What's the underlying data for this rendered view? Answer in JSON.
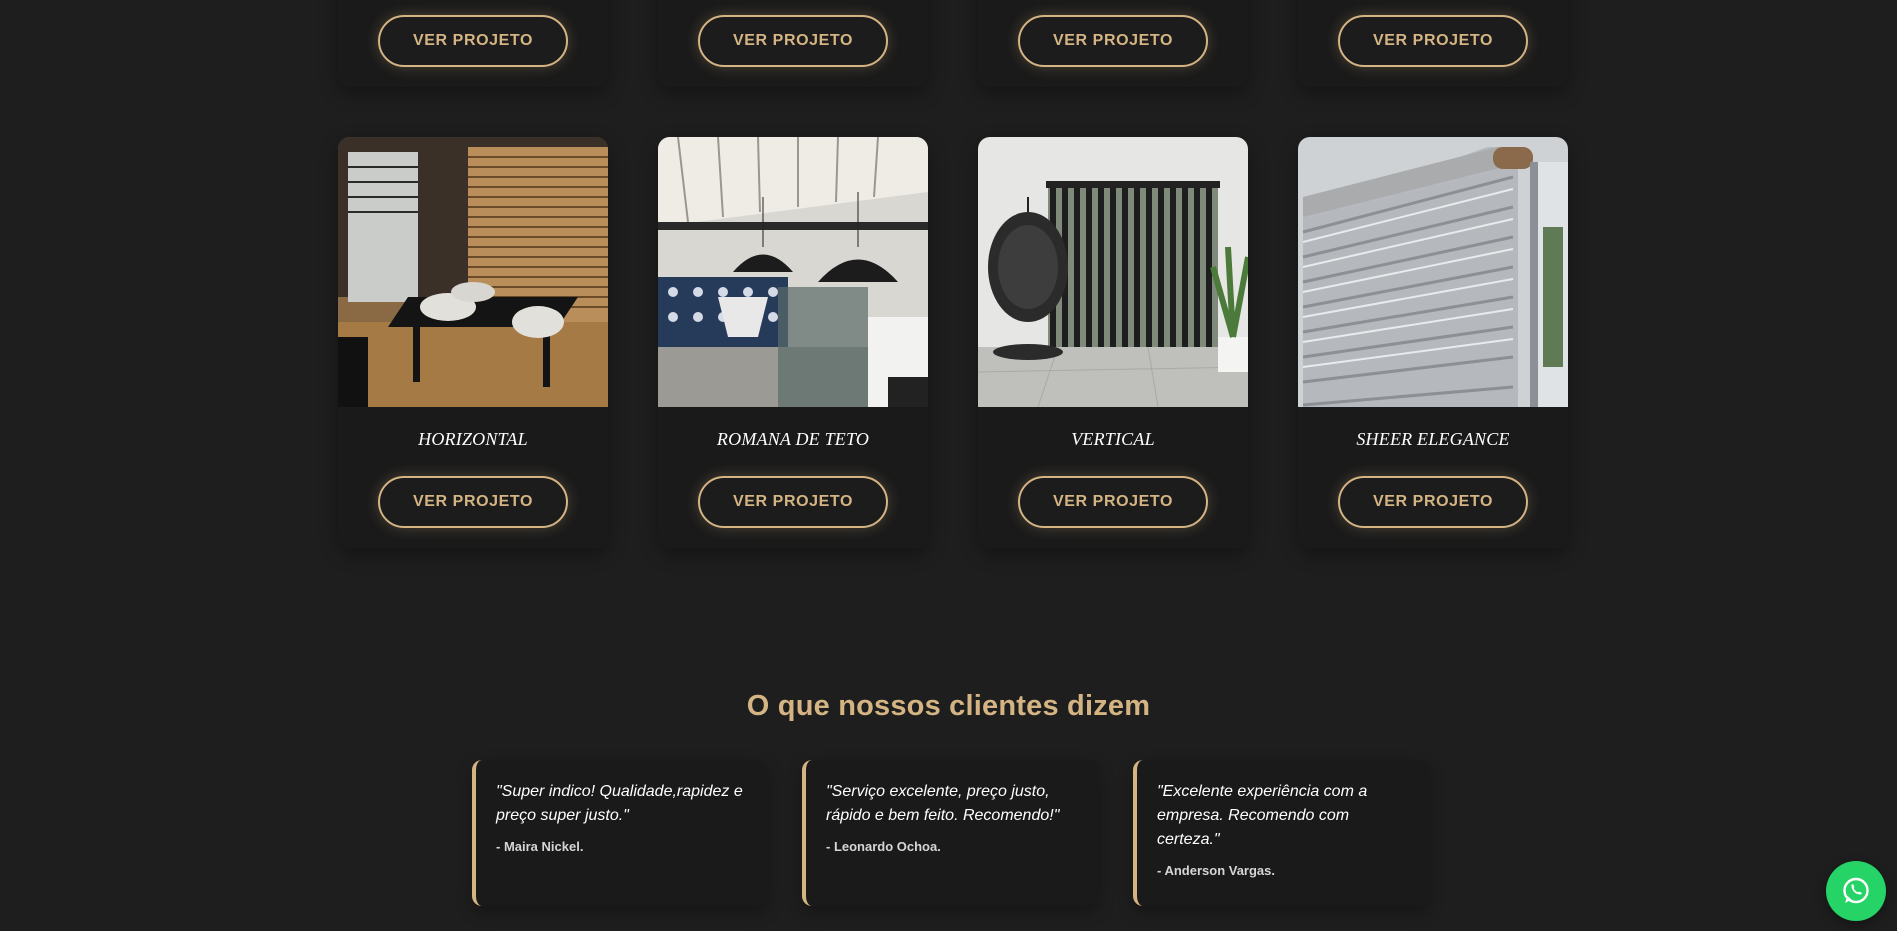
{
  "projects_top_row": [
    {
      "button_label": "VER PROJETO"
    },
    {
      "button_label": "VER PROJETO"
    },
    {
      "button_label": "VER PROJETO"
    },
    {
      "button_label": "VER PROJETO"
    }
  ],
  "projects": [
    {
      "title": "HORIZONTAL",
      "button_label": "VER PROJETO",
      "image": "horizontal-blinds-dining-room-photo"
    },
    {
      "title": "ROMANA DE TETO",
      "button_label": "VER PROJETO",
      "image": "roman-ceiling-shade-patio-photo"
    },
    {
      "title": "VERTICAL",
      "button_label": "VER PROJETO",
      "image": "vertical-blinds-living-room-photo"
    },
    {
      "title": "SHEER ELEGANCE",
      "button_label": "VER PROJETO",
      "image": "sheer-elegance-blind-closeup-photo"
    }
  ],
  "testimonials": {
    "heading": "O que nossos clientes dizem",
    "items": [
      {
        "quote": "\"Super indico! Qualidade,rapidez e preço super justo.\"",
        "author": "- Maira Nickel."
      },
      {
        "quote": "\"Serviço excelente, preço justo, rápido e bem feito. Recomendo!\"",
        "author": "- Leonardo Ochoa."
      },
      {
        "quote": "\"Excelente experiência com a empresa. Recomendo com certeza.\"",
        "author": "- Anderson Vargas."
      }
    ]
  },
  "floating": {
    "icon": "whatsapp-icon"
  },
  "colors": {
    "background": "#1e1e1e",
    "card": "#1a1a1a",
    "accent_gold": "#d4b483",
    "whatsapp_green": "#25d366"
  }
}
